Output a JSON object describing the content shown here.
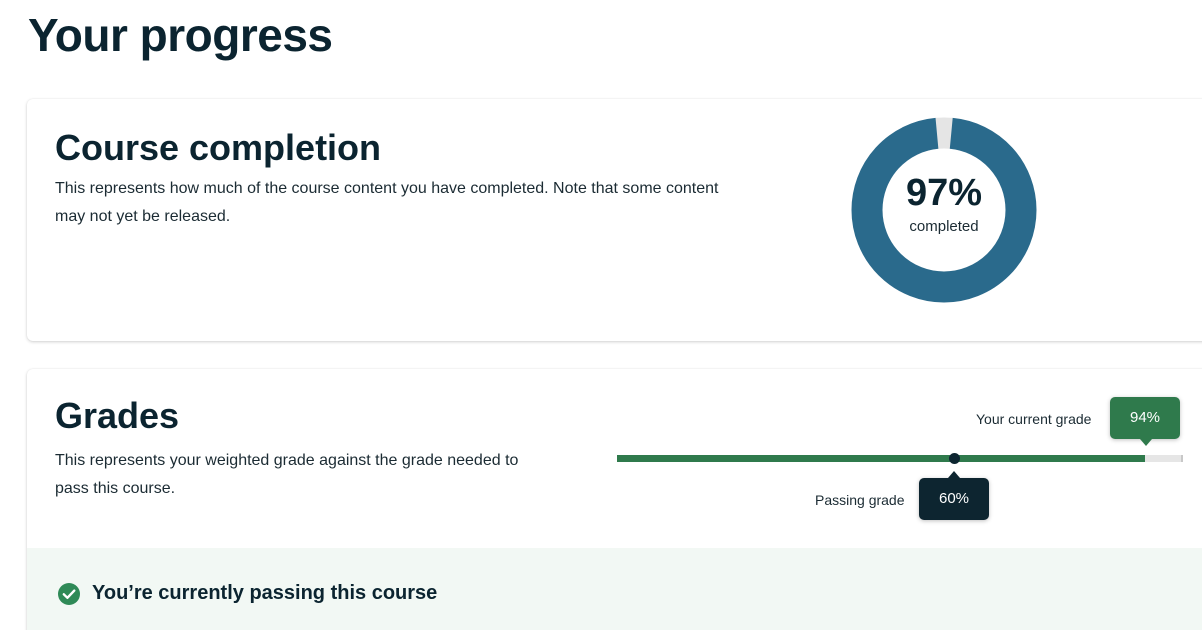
{
  "page": {
    "title": "Your progress"
  },
  "completion": {
    "title": "Course completion",
    "description": "This represents how much of the course content you have completed. Note that some content may not yet be released.",
    "percent_label": "97%",
    "percent_value": 97,
    "caption": "completed",
    "color_complete": "#2a6a8c",
    "color_remaining": "#e5e5e5"
  },
  "grades": {
    "title": "Grades",
    "description": "This represents your weighted grade against the grade needed to pass this course.",
    "current_grade_label": "Your current grade",
    "current_grade": "94%",
    "current_grade_value": 94,
    "passing_grade_label": "Passing grade",
    "passing_grade": "60%",
    "passing_grade_value": 60,
    "color_current": "#2f7a4c",
    "color_passing": "#0d2530"
  },
  "status": {
    "icon": "check-circle-icon",
    "text": "You’re currently passing this course",
    "color": "#2f8a57"
  }
}
